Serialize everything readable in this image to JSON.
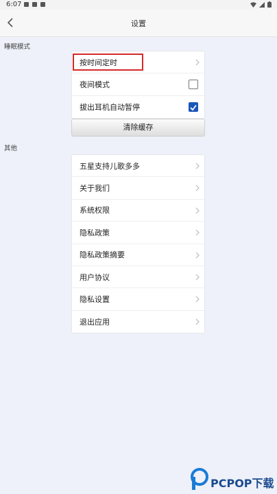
{
  "status_bar": {
    "time": "6:07"
  },
  "header": {
    "title": "设置"
  },
  "sections": {
    "sleep": {
      "label": "睡眠模式"
    },
    "other": {
      "label": "其他"
    }
  },
  "sleep_items": [
    {
      "label": "按时间定时"
    },
    {
      "label": "夜间模式",
      "checked": false
    },
    {
      "label": "拔出耳机自动暂停",
      "checked": true
    }
  ],
  "clear_cache": {
    "label": "清除缓存"
  },
  "other_items": [
    {
      "label": "五星支持儿歌多多"
    },
    {
      "label": "关于我们"
    },
    {
      "label": "系统权限"
    },
    {
      "label": "隐私政策"
    },
    {
      "label": "隐私政策摘要"
    },
    {
      "label": "用户协议"
    },
    {
      "label": "隐私设置"
    },
    {
      "label": "退出应用"
    }
  ],
  "watermark": {
    "text": "PCPOP下载"
  },
  "colors": {
    "checkbox_checked": "#1a56b9",
    "highlight": "#d42a2a",
    "background": "#eef1f9"
  }
}
